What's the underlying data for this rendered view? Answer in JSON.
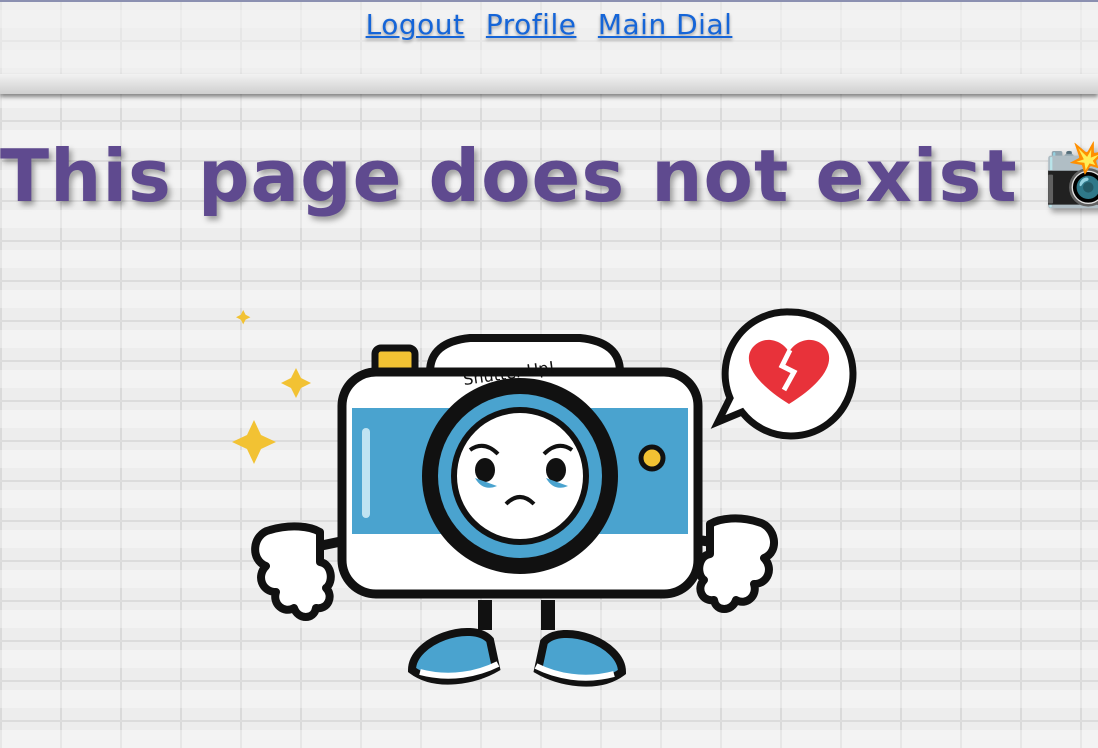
{
  "nav": {
    "logout": "Logout",
    "profile": "Profile",
    "main_dial": "Main Dial"
  },
  "page": {
    "title": "This page does not exist",
    "title_emoji": "📸"
  },
  "illustration": {
    "camera_text": "Shutter-Up!",
    "icons": [
      "sad-camera-icon",
      "broken-heart-icon",
      "sparkle-icon",
      "thumbs-down-icon"
    ]
  },
  "colors": {
    "link": "#1565d8",
    "title": "#5f4a8f",
    "camera_blue": "#4aa3cf",
    "heart_red": "#e8323a",
    "sparkle_gold": "#f2c233"
  }
}
